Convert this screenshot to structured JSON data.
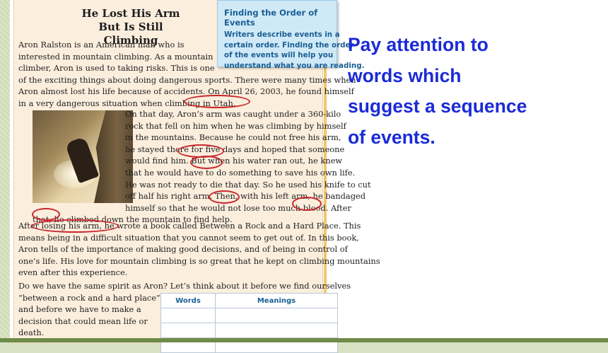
{
  "textbook": {
    "title_line1": "He Lost His Arm",
    "title_line2": "But Is Still Climbing",
    "intro_lines": [
      "Aron Ralston is an American man who is",
      "interested in mountain climbing. As a mountain",
      "climber, Aron is used to taking risks. This is one",
      "of the exciting things about doing dangerous sports. There were many times when",
      "Aron almost lost his life because of accidents. On April 26, 2003, he found himself",
      "in a very dangerous situation when climbing in Utah."
    ],
    "story_lines": [
      "On that day, Aron’s arm was caught under a 360-kilo",
      "rock that fell on him when he was climbing by himself",
      "in the mountains. Because he could not free his arm,",
      "he stayed there for five days and hoped that someone",
      "would find him. But when his water ran out, he knew",
      "that he would have to do something to save his own life.",
      "He was not ready to die that day. So he used his knife to cut",
      "off half his right arm. Then, with his left arm, he bandaged",
      "himself so that he would not lose too much blood. After",
      "that, he climbed down the mountain to find help."
    ],
    "after_lines": [
      "After losing his arm, he wrote a book called Between a Rock and a Hard Place. This",
      "means being in a difficult situation that you cannot seem to get out of. In this book,",
      "Aron tells of the importance of making good decisions, and of being in control of",
      "one’s life. His love for mountain climbing is so great that he kept on climbing mountains",
      "even after this experience."
    ],
    "question_lines": [
      "Do we have the same spirit as Aron? Let’s think about it before we find ourselves",
      "“between a rock and a hard place”,",
      "and before we have to make a",
      "decision that could mean life or",
      "death."
    ],
    "callout_title": "Finding the Order of Events",
    "callout_lines": [
      "Writers describe events in a",
      "certain order. Finding the order",
      "of the events will help you",
      "understand what you are reading."
    ],
    "table_headers": [
      "Words",
      "Meanings"
    ]
  },
  "slide_text_lines": [
    "Pay attention to",
    "words which",
    "suggest a sequence",
    "of events."
  ],
  "colors": {
    "slide_text": "#1b2bd6",
    "circle": "#c9272d",
    "callout_bg": "#cfe9f7",
    "page_bg": "#fbeedd"
  }
}
